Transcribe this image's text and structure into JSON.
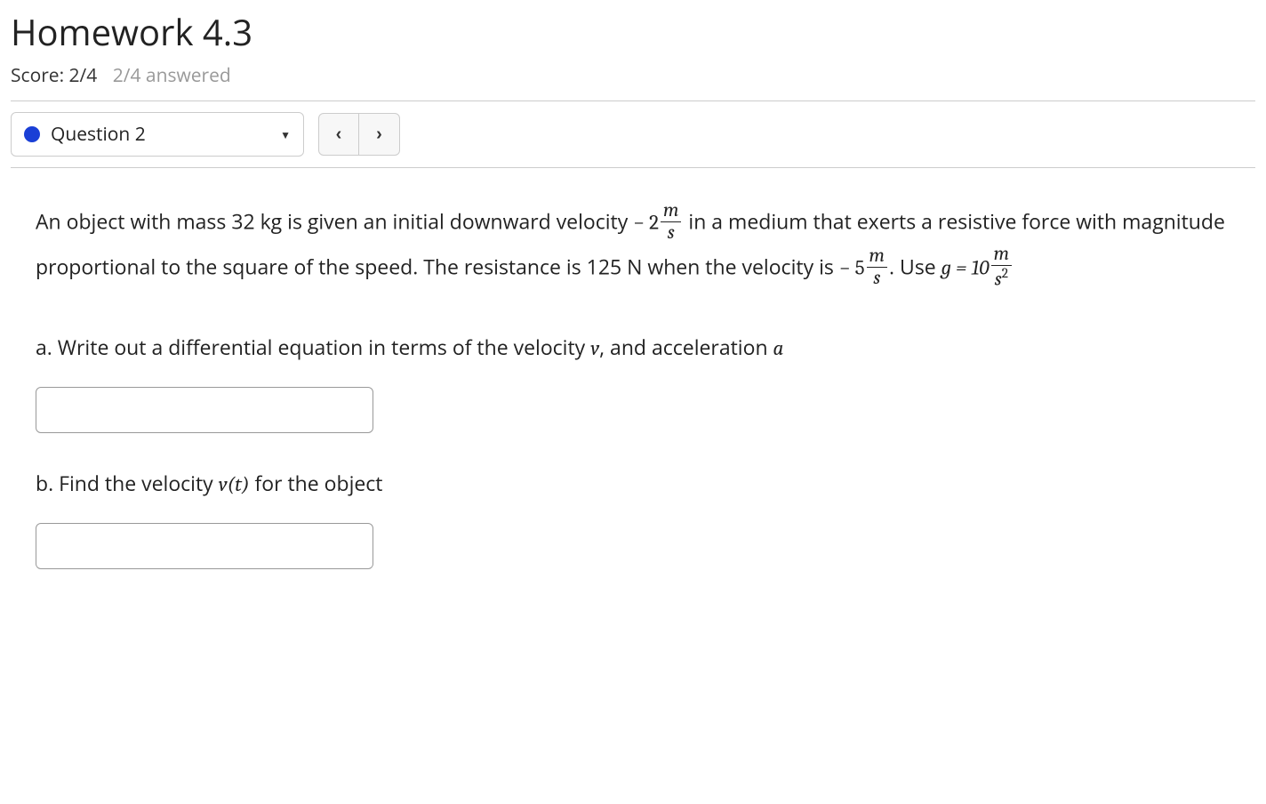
{
  "header": {
    "title": "Homework 4.3",
    "score_label": "Score: 2/4",
    "answered_label": "2/4 answered"
  },
  "nav": {
    "question_label": "Question 2",
    "prev_symbol": "‹",
    "next_symbol": "›"
  },
  "problem": {
    "text1": "An object with mass 32 kg is given an initial downward velocity ",
    "v0_coef": "− 2",
    "frac1_num": "m",
    "frac1_den": "s",
    "text2": " in a medium that exerts a resistive force with magnitude proportional to the square of the speed. The resistance is 125 N when the velocity is ",
    "vr_coef": "− 5",
    "frac2_num": "m",
    "frac2_den": "s",
    "text3": ". Use ",
    "g_eq": "g = 10",
    "frac3_num": "m",
    "frac3_den_base": "s",
    "frac3_den_exp": "2"
  },
  "parts": {
    "a_text1": "a. Write out a differential equation in terms of the velocity ",
    "a_v": "v",
    "a_text2": ", and acceleration ",
    "a_a": "a",
    "b_text1": "b. Find the velocity ",
    "b_vt": "v(t)",
    "b_text2": " for the object"
  }
}
